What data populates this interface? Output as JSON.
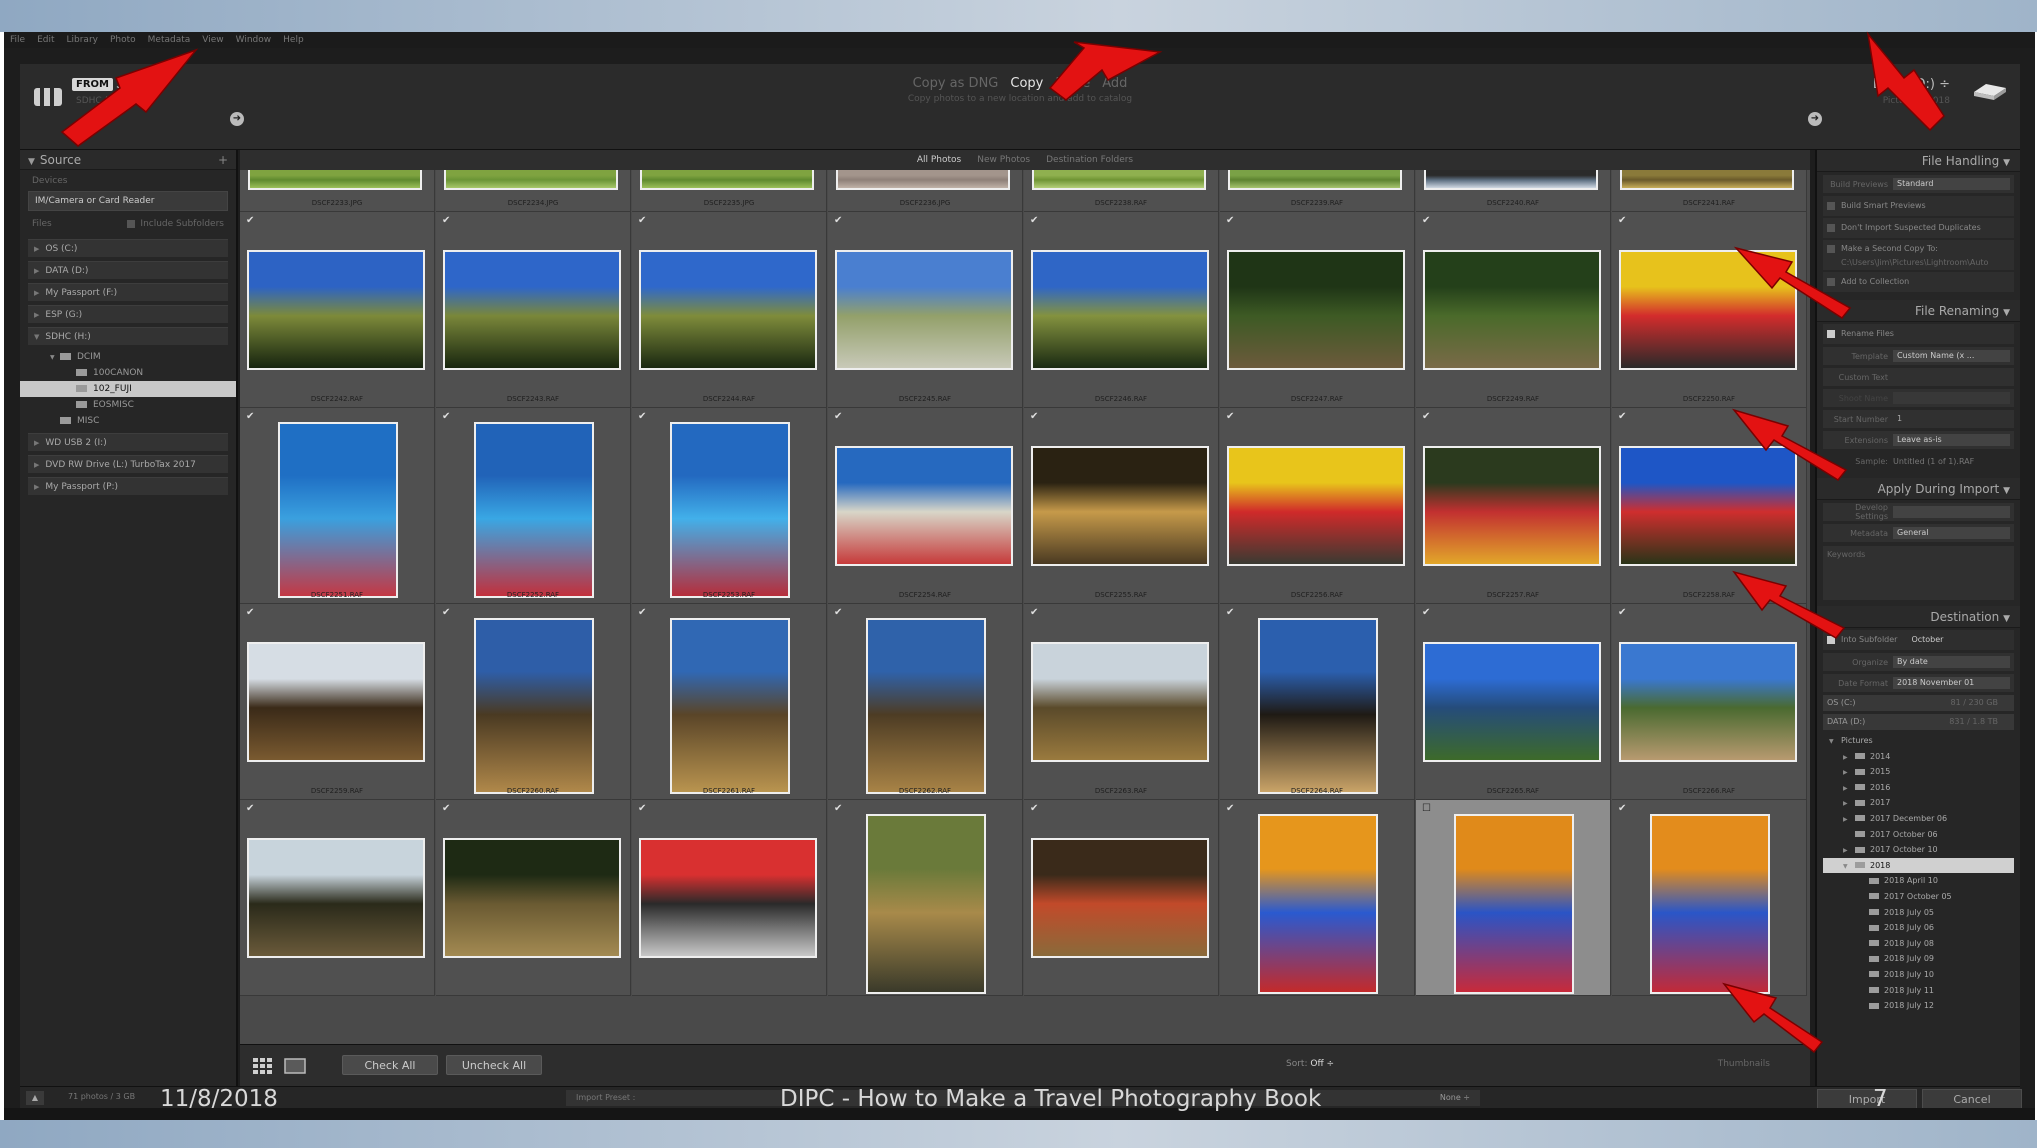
{
  "menu": [
    "File",
    "Edit",
    "Library",
    "Photo",
    "Metadata",
    "View",
    "Window",
    "Help"
  ],
  "header": {
    "from_label": "FROM",
    "source_name": "SDHC",
    "source_sub": "SDHC (H)",
    "modes": [
      "Copy as DNG",
      "Copy",
      "Move",
      "Add"
    ],
    "active_mode": "Copy",
    "mode_desc": "Copy photos to a new location and add to catalog",
    "dest_name": "DATA (D:) ÷",
    "dest_sub": "Pictures \\ 2018",
    "source_arrow_icon": "circle-arrow-left-icon",
    "dest_arrow_icon": "circle-arrow-right-icon"
  },
  "source_panel": {
    "title": "Source",
    "devices_label": "Devices",
    "device": "IM/Camera or Card Reader",
    "files_label": "Files",
    "include_subfolders": "Include Subfolders",
    "volumes": [
      {
        "name": "OS (C:)",
        "expanded": false
      },
      {
        "name": "DATA (D:)",
        "expanded": false
      },
      {
        "name": "My Passport (F:)",
        "expanded": false
      },
      {
        "name": "ESP (G:)",
        "expanded": false
      },
      {
        "name": "SDHC (H:)",
        "expanded": true
      }
    ],
    "tree": [
      {
        "label": "DCIM",
        "indent": 1,
        "selected": false
      },
      {
        "label": "100CANON",
        "indent": 2,
        "selected": false
      },
      {
        "label": "102_FUJI",
        "indent": 2,
        "selected": true
      },
      {
        "label": "EOSMISC",
        "indent": 2,
        "selected": false
      },
      {
        "label": "MISC",
        "indent": 1,
        "selected": false
      }
    ],
    "volumes_after": [
      {
        "name": "WD USB 2 (I:)"
      },
      {
        "name": "DVD RW Drive (L:) TurboTax 2017"
      },
      {
        "name": "My Passport (P:)"
      }
    ]
  },
  "grid": {
    "tabs": [
      "All Photos",
      "New Photos",
      "Destination Folders"
    ],
    "active_tab": "All Photos",
    "rows": [
      {
        "partial": true,
        "items": [
          {
            "file": "DSCF2233.JPG",
            "checked": true,
            "orient": "land",
            "colors": [
              "#7fa340",
              "#5f8a2e",
              "#9cc05a"
            ]
          },
          {
            "file": "DSCF2234.JPG",
            "checked": true,
            "orient": "land",
            "colors": [
              "#7fa340",
              "#6b9536",
              "#a8c86a"
            ]
          },
          {
            "file": "DSCF2235.JPG",
            "checked": true,
            "orient": "land",
            "colors": [
              "#7fa340",
              "#5f8a2e",
              "#9cc05a"
            ]
          },
          {
            "file": "DSCF2236.JPG",
            "checked": true,
            "orient": "land",
            "colors": [
              "#a3958c",
              "#8e8078",
              "#c0b2a8"
            ]
          },
          {
            "file": "DSCF2238.RAF",
            "checked": true,
            "orient": "land",
            "colors": [
              "#8fb04f",
              "#6f9434",
              "#b4cf78"
            ]
          },
          {
            "file": "DSCF2239.RAF",
            "checked": true,
            "orient": "land",
            "colors": [
              "#7aa146",
              "#5d8330",
              "#a6c46e"
            ]
          },
          {
            "file": "DSCF2240.RAF",
            "checked": true,
            "orient": "land",
            "colors": [
              "#2b2b2b",
              "#5c6e80",
              "#cfd8e2"
            ]
          },
          {
            "file": "DSCF2241.RAF",
            "checked": true,
            "orient": "land",
            "colors": [
              "#8a7a3a",
              "#6a5a2a",
              "#c7ad58"
            ]
          }
        ]
      },
      {
        "partial": false,
        "items": [
          {
            "file": "DSCF2242.RAF",
            "checked": true,
            "orient": "land",
            "colors": [
              "#2d63c4",
              "#7d8a3a",
              "#16240f"
            ]
          },
          {
            "file": "DSCF2243.RAF",
            "checked": true,
            "orient": "land",
            "colors": [
              "#2e66c9",
              "#7a873a",
              "#18260f"
            ]
          },
          {
            "file": "DSCF2244.RAF",
            "checked": true,
            "orient": "land",
            "colors": [
              "#2f68cb",
              "#7f8c3b",
              "#1a2811"
            ]
          },
          {
            "file": "DSCF2245.RAF",
            "checked": true,
            "orient": "land",
            "colors": [
              "#4a7fd0",
              "#93a06a",
              "#c8c9b8"
            ]
          },
          {
            "file": "DSCF2246.RAF",
            "checked": true,
            "orient": "land",
            "colors": [
              "#2f66c6",
              "#84923f",
              "#1a2a12"
            ]
          },
          {
            "file": "DSCF2247.RAF",
            "checked": true,
            "orient": "land",
            "colors": [
              "#1f3516",
              "#3d5a24",
              "#6c5a3c"
            ]
          },
          {
            "file": "DSCF2249.RAF",
            "checked": true,
            "orient": "land",
            "colors": [
              "#24401a",
              "#4a6a2a",
              "#7a6a48"
            ]
          },
          {
            "file": "DSCF2250.RAF",
            "checked": true,
            "orient": "land",
            "colors": [
              "#e7c21c",
              "#d32c2c",
              "#2a2a2a"
            ]
          }
        ]
      },
      {
        "partial": false,
        "items": [
          {
            "file": "DSCF2251.RAF",
            "checked": true,
            "orient": "port",
            "colors": [
              "#1f6fc4",
              "#3aa0df",
              "#c43844"
            ]
          },
          {
            "file": "DSCF2252.RAF",
            "checked": true,
            "orient": "port",
            "colors": [
              "#2163b8",
              "#39a7e4",
              "#c2303c"
            ]
          },
          {
            "file": "DSCF2253.RAF",
            "checked": true,
            "orient": "port",
            "colors": [
              "#2369c0",
              "#42b0ea",
              "#b62d3a"
            ]
          },
          {
            "file": "DSCF2254.RAF",
            "checked": true,
            "orient": "land",
            "colors": [
              "#2669bf",
              "#d8d6c8",
              "#c63a3a"
            ]
          },
          {
            "file": "DSCF2255.RAF",
            "checked": true,
            "orient": "land",
            "colors": [
              "#2a2212",
              "#c69a4a",
              "#4a3a22"
            ]
          },
          {
            "file": "DSCF2256.RAF",
            "checked": true,
            "orient": "land",
            "colors": [
              "#e8c51b",
              "#d02a2a",
              "#3a3a32"
            ]
          },
          {
            "file": "DSCF2257.RAF",
            "checked": true,
            "orient": "land",
            "colors": [
              "#2b3a1e",
              "#c23030",
              "#e2a72a"
            ]
          },
          {
            "file": "DSCF2258.RAF",
            "checked": true,
            "orient": "land",
            "colors": [
              "#1e56c6",
              "#cf2e2e",
              "#2a3418"
            ]
          }
        ]
      },
      {
        "partial": false,
        "items": [
          {
            "file": "DSCF2259.RAF",
            "checked": true,
            "orient": "land",
            "colors": [
              "#d6dde4",
              "#3a2a18",
              "#7a5a30"
            ]
          },
          {
            "file": "DSCF2260.RAF",
            "checked": true,
            "orient": "port",
            "colors": [
              "#2e5ea8",
              "#4a3a22",
              "#b0884a"
            ]
          },
          {
            "file": "DSCF2261.RAF",
            "checked": true,
            "orient": "port",
            "colors": [
              "#3068b4",
              "#5a4528",
              "#b9944f"
            ]
          },
          {
            "file": "DSCF2262.RAF",
            "checked": true,
            "orient": "port",
            "colors": [
              "#2f62aa",
              "#4d3c24",
              "#a88346"
            ]
          },
          {
            "file": "DSCF2263.RAF",
            "checked": true,
            "orient": "land",
            "colors": [
              "#c9d3db",
              "#5a4a2a",
              "#9a7a3e"
            ]
          },
          {
            "file": "DSCF2264.RAF",
            "checked": true,
            "orient": "port",
            "colors": [
              "#2b5fae",
              "#1f1a14",
              "#caa468"
            ]
          },
          {
            "file": "DSCF2265.RAF",
            "checked": true,
            "orient": "land",
            "colors": [
              "#2d6cd4",
              "#254c7a",
              "#3d6a2a"
            ]
          },
          {
            "file": "DSCF2266.RAF",
            "checked": true,
            "orient": "land",
            "colors": [
              "#3a78d0",
              "#4a6a30",
              "#b89a70"
            ]
          }
        ]
      },
      {
        "partial": true,
        "items": [
          {
            "file": "DSCF2267.RAF",
            "checked": true,
            "orient": "land",
            "colors": [
              "#c8d4dc",
              "#2a2a1a",
              "#6a5a3a"
            ]
          },
          {
            "file": "DSCF2268.RAF",
            "checked": true,
            "orient": "land",
            "colors": [
              "#1e2a14",
              "#6a5a32",
              "#a38a52"
            ]
          },
          {
            "file": "DSCF2269.RAF",
            "checked": true,
            "orient": "land",
            "colors": [
              "#d93030",
              "#2a2a2a",
              "#c8c8c8"
            ]
          },
          {
            "file": "DSCF2270.RAF",
            "checked": true,
            "orient": "port",
            "colors": [
              "#6a7a3a",
              "#a88a4a",
              "#3a3a2a"
            ]
          },
          {
            "file": "DSCF2271.RAF",
            "checked": true,
            "orient": "land",
            "colors": [
              "#3a2a1a",
              "#c24a2a",
              "#8a6a3a"
            ]
          },
          {
            "file": "DSCF2272.RAF",
            "checked": true,
            "orient": "port",
            "colors": [
              "#e6961c",
              "#2a5ad0",
              "#c42a2a"
            ]
          },
          {
            "file": "DSCF2273.RAF",
            "checked": false,
            "orient": "port",
            "colors": [
              "#e08a1a",
              "#2a54c6",
              "#c82a3a"
            ],
            "highlight": true
          },
          {
            "file": "DSCF2274.RAF",
            "checked": true,
            "orient": "port",
            "colors": [
              "#e38c1c",
              "#2a56c8",
              "#c22a38"
            ]
          }
        ]
      }
    ]
  },
  "toolbar": {
    "grid_icon": "grid-view-icon",
    "loupe_icon": "loupe-view-icon",
    "check_all": "Check All",
    "uncheck_all": "Uncheck All",
    "sort_label": "Sort:",
    "sort_value": "Off ÷",
    "thumbnails_label": "Thumbnails"
  },
  "right_panel": {
    "file_handling": {
      "title": "File Handling",
      "build_previews_label": "Build Previews",
      "build_previews_value": "Standard",
      "smart_previews": "Build Smart Previews",
      "no_duplicates": "Don't Import Suspected Duplicates",
      "second_copy": "Make a Second Copy To:",
      "second_copy_path": "C:\\Users\\Jim\\Pictures\\Lightroom\\Auto",
      "add_collection": "Add to Collection"
    },
    "file_renaming": {
      "title": "File Renaming",
      "rename_files": "Rename Files",
      "template_label": "Template",
      "template_value": "Custom Name (x ...",
      "custom_text_label": "Custom Text",
      "shoot_name_label": "Shoot Name",
      "start_number_label": "Start Number",
      "start_number_value": "1",
      "extensions_label": "Extensions",
      "extensions_value": "Leave as-is",
      "sample_label": "Sample:",
      "sample_value": "Untitled (1 of 1).RAF"
    },
    "apply": {
      "title": "Apply During Import",
      "develop_label": "Develop Settings",
      "develop_value": "",
      "metadata_label": "Metadata",
      "metadata_value": "General",
      "keywords_label": "Keywords"
    },
    "destination": {
      "title": "Destination",
      "into_subfolder": "Into Subfolder",
      "subfolder_value": "October",
      "organize_label": "Organize",
      "organize_value": "By date",
      "date_format_label": "Date Format",
      "date_format_value": "2018 November 01",
      "volumes": [
        {
          "name": "OS (C:)",
          "info": "81 / 230 GB"
        },
        {
          "name": "DATA (D:)",
          "info": "831 / 1.8 TB"
        }
      ],
      "tree": [
        {
          "label": "Pictures",
          "indent": 0,
          "selected": false,
          "arrow": "open"
        },
        {
          "label": "2014",
          "indent": 1,
          "selected": false,
          "arrow": "closed"
        },
        {
          "label": "2015",
          "indent": 1,
          "selected": false,
          "arrow": "closed"
        },
        {
          "label": "2016",
          "indent": 1,
          "selected": false,
          "arrow": "closed"
        },
        {
          "label": "2017",
          "indent": 1,
          "selected": false,
          "arrow": "closed"
        },
        {
          "label": "2017 December 06",
          "indent": 1,
          "selected": false,
          "arrow": "closed"
        },
        {
          "label": "2017 October 06",
          "indent": 1,
          "selected": false,
          "arrow": "none"
        },
        {
          "label": "2017 October 10",
          "indent": 1,
          "selected": false,
          "arrow": "closed"
        },
        {
          "label": "2018",
          "indent": 1,
          "selected": true,
          "arrow": "open"
        },
        {
          "label": "2018 April 10",
          "indent": 2,
          "selected": false,
          "arrow": "none"
        },
        {
          "label": "2017 October 05",
          "indent": 2,
          "selected": false,
          "arrow": "none"
        },
        {
          "label": "2018 July 05",
          "indent": 2,
          "selected": false,
          "arrow": "none"
        },
        {
          "label": "2018 July 06",
          "indent": 2,
          "selected": false,
          "arrow": "none"
        },
        {
          "label": "2018 July 08",
          "indent": 2,
          "selected": false,
          "arrow": "none"
        },
        {
          "label": "2018 July 09",
          "indent": 2,
          "selected": false,
          "arrow": "none"
        },
        {
          "label": "2018 July 10",
          "indent": 2,
          "selected": false,
          "arrow": "none"
        },
        {
          "label": "2018 July 11",
          "indent": 2,
          "selected": false,
          "arrow": "none"
        },
        {
          "label": "2018 July 12",
          "indent": 2,
          "selected": false,
          "arrow": "none"
        }
      ]
    }
  },
  "bottom": {
    "count": "71 photos / 3 GB",
    "preset_label": "Import Preset :",
    "preset_value": "None ÷",
    "import": "Import",
    "cancel": "Cancel"
  },
  "footer": {
    "date": "11/8/2018",
    "title": "DIPC - How to Make a Travel Photography Book",
    "page": "7"
  },
  "colors": {
    "arrow_red": "#e31212",
    "panel": "#262626",
    "grid_bg": "#4a4a4a",
    "cell_bg": "#505050",
    "highlight_cell": "#8d8d8d"
  }
}
